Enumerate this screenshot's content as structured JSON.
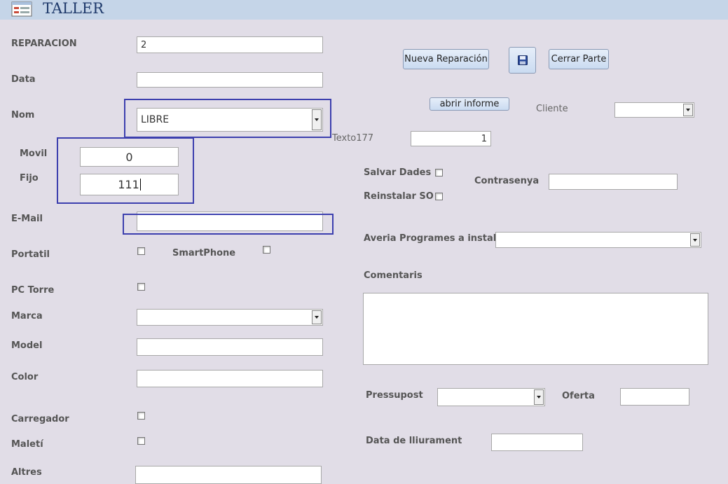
{
  "header": {
    "title": "TALLER",
    "icon": "form-icon"
  },
  "left": {
    "reparacion": {
      "label": "REPARACION",
      "value": "2"
    },
    "data": {
      "label": "Data",
      "value": ""
    },
    "nom": {
      "label": "Nom",
      "value": "LIBRE"
    },
    "movil": {
      "label": "Movil",
      "value": "0"
    },
    "fijo": {
      "label": "Fijo",
      "value": "111"
    },
    "email": {
      "label": "E-Mail",
      "value": ""
    },
    "portatil": {
      "label": "Portatil"
    },
    "smartphone": {
      "label": "SmartPhone"
    },
    "pctorre": {
      "label": "PC Torre"
    },
    "marca": {
      "label": "Marca",
      "value": ""
    },
    "model": {
      "label": "Model",
      "value": ""
    },
    "color": {
      "label": "Color",
      "value": ""
    },
    "carregador": {
      "label": "Carregador"
    },
    "maleti": {
      "label": "Maletí"
    },
    "altres": {
      "label": "Altres",
      "value": ""
    }
  },
  "right": {
    "buttons": {
      "nueva": "Nueva Reparación",
      "save": "save-icon",
      "cerrar": "Cerrar Parte",
      "abrir": "abrir informe"
    },
    "cliente": {
      "label": "Cliente",
      "value": ""
    },
    "texto177": {
      "label": "Texto177",
      "value": "1"
    },
    "salvar": {
      "label": "Salvar Dades"
    },
    "reinstalar": {
      "label": "Reinstalar SO"
    },
    "contrasenya": {
      "label": "Contrasenya",
      "value": ""
    },
    "averia": {
      "label": "Averia Programes a instalar",
      "value": ""
    },
    "comentaris": {
      "label": "Comentaris",
      "value": ""
    },
    "pressupost": {
      "label": "Pressupost",
      "value": ""
    },
    "oferta": {
      "label": "Oferta",
      "value": ""
    },
    "lliurament": {
      "label": "Data de lliurament",
      "value": ""
    }
  },
  "colors": {
    "highlight": "#3c3fae",
    "header_bg": "#c5d5e8",
    "form_bg": "#e1dde7"
  }
}
